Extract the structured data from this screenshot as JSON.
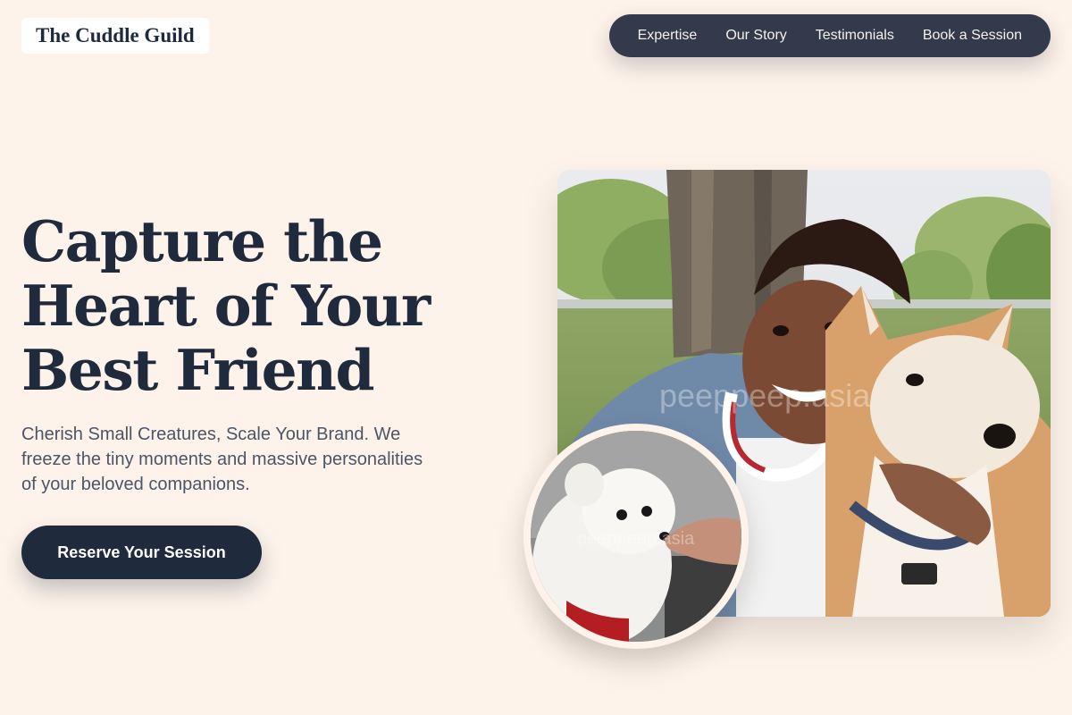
{
  "header": {
    "logo": "The Cuddle Guild",
    "nav": [
      "Expertise",
      "Our Story",
      "Testimonials",
      "Book a Session"
    ]
  },
  "hero": {
    "headline_lines": [
      "Capture the",
      "Heart of Your",
      "Best Friend"
    ],
    "subtitle": "Cherish Small Creatures, Scale Your Brand. We freeze the tiny moments and massive personalities of your beloved companions.",
    "cta": "Reserve Your Session"
  },
  "images": {
    "main_watermark": "peeppeep.asia",
    "round_watermark": "peeppeep.asia"
  },
  "colors": {
    "background": "#fdf3ea",
    "navy": "#1f2a3d",
    "nav_bg": "#323a4b"
  }
}
